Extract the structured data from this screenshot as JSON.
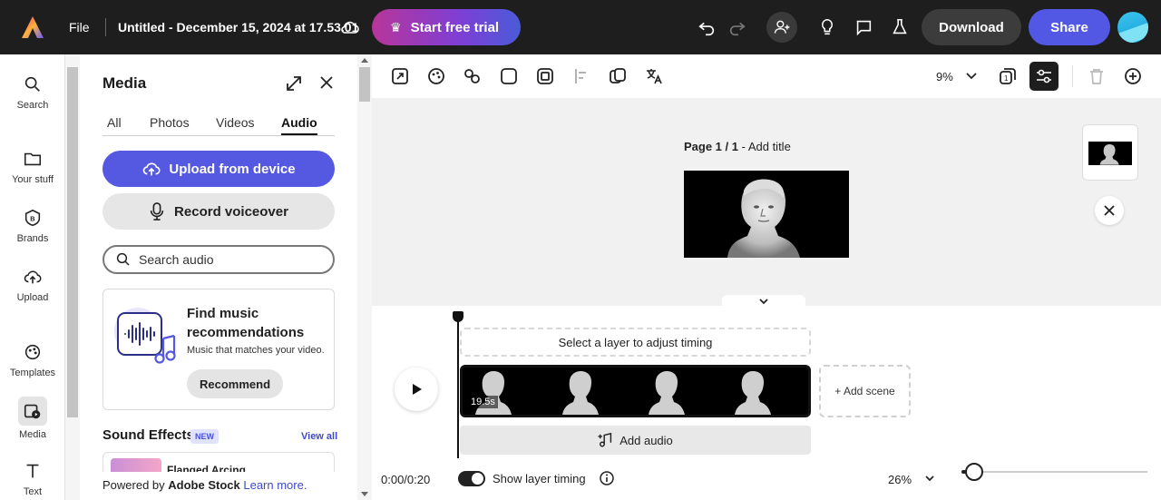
{
  "topbar": {
    "file_label": "File",
    "doc_title": "Untitled - December 15, 2024 at 17.53.01",
    "trial_label": "Start free trial",
    "download_label": "Download",
    "share_label": "Share"
  },
  "rail": {
    "items": [
      {
        "label": "Search",
        "icon": "search-icon"
      },
      {
        "label": "Your stuff",
        "icon": "folder-icon"
      },
      {
        "label": "Brands",
        "icon": "brand-icon"
      },
      {
        "label": "Upload",
        "icon": "upload-icon"
      },
      {
        "label": "Templates",
        "icon": "templates-icon"
      },
      {
        "label": "Media",
        "icon": "media-icon"
      },
      {
        "label": "Text",
        "icon": "text-icon"
      }
    ]
  },
  "panel": {
    "title": "Media",
    "tabs": [
      "All",
      "Photos",
      "Videos",
      "Audio"
    ],
    "active_tab": "Audio",
    "upload_label": "Upload from device",
    "voiceover_label": "Record voiceover",
    "search_placeholder": "Search audio",
    "reco": {
      "title": "Find music recommendations",
      "subtitle": "Music that matches your video.",
      "button": "Recommend"
    },
    "sfx_title": "Sound Effects",
    "new_badge": "NEW",
    "view_all": "View all",
    "sfx_item": "Flanged Arcing",
    "powered_prefix": "Powered by ",
    "powered_brand": "Adobe Stock",
    "powered_suffix": ".",
    "learn_more": "Learn more."
  },
  "canvas": {
    "zoom": "9%",
    "page_prefix": "Page 1 / 1",
    "page_title_hint": " - Add title"
  },
  "timeline": {
    "timing_hint": "Select a layer to adjust timing",
    "duration": "19.5s",
    "add_scene": "+ Add scene",
    "add_audio": "Add audio",
    "time": "0:00/0:20",
    "show_timing": "Show layer timing",
    "zoom": "26%",
    "zoom_level": 0.07
  },
  "colors": {
    "accent": "#5558e0",
    "topbar": "#1e1e1e"
  }
}
